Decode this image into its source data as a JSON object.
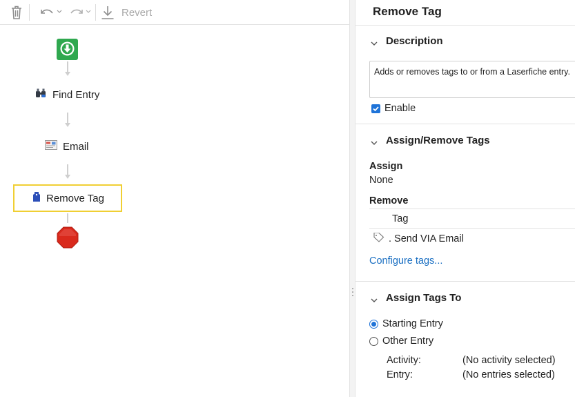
{
  "toolbar": {
    "revert_label": "Revert",
    "icons": [
      "trash-icon",
      "undo-icon",
      "redo-icon",
      "download-icon"
    ]
  },
  "workflow": {
    "nodes": [
      {
        "type": "start",
        "icon": "start-download-icon",
        "color": "#2fa84f"
      },
      {
        "type": "activity",
        "label": "Find Entry",
        "icon": "binoculars-icon"
      },
      {
        "type": "activity",
        "label": "Email",
        "icon": "email-icon"
      },
      {
        "type": "activity",
        "label": "Remove Tag",
        "icon": "tag-icon",
        "selected": true
      },
      {
        "type": "end",
        "icon": "stop-octagon-icon",
        "color": "#d9291c"
      }
    ],
    "selection_color": "#f0cf33"
  },
  "panel": {
    "title": "Remove Tag",
    "description": {
      "heading": "Description",
      "text": "Adds or removes tags to or from a Laserfiche entry.",
      "enable_label": "Enable",
      "enabled": true
    },
    "assign_remove": {
      "heading": "Assign/Remove Tags",
      "assign_label": "Assign",
      "assign_value": "None",
      "remove_label": "Remove",
      "table_header": "Tag",
      "tags": [
        ". Send VIA Email"
      ],
      "configure_link": "Configure tags..."
    },
    "assign_to": {
      "heading": "Assign Tags To",
      "options": [
        "Starting Entry",
        "Other Entry"
      ],
      "selected": "Starting Entry",
      "activity_label": "Activity:",
      "activity_value": "(No activity selected)",
      "entry_label": "Entry:",
      "entry_value": "(No entries selected)"
    }
  },
  "colors": {
    "accent": "#1e73d8",
    "link": "#1a6fc2"
  }
}
